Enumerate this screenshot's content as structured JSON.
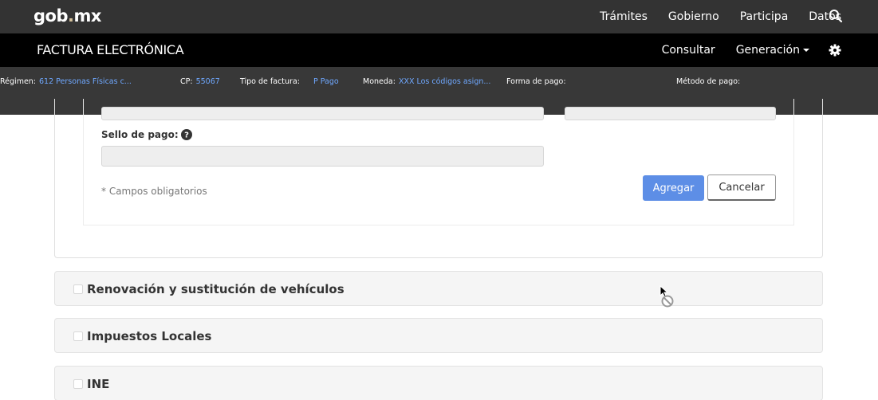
{
  "topbar": {
    "logo_left": "gob",
    "logo_dot": ".",
    "logo_right": "mx",
    "nav": [
      "Trámites",
      "Gobierno",
      "Participa",
      "Datos"
    ]
  },
  "subbar": {
    "title": "FACTURA ELECTRÓNICA",
    "consultar": "Consultar",
    "generacion": "Generación"
  },
  "infobar": {
    "regimen_label": "Régimen:",
    "regimen_value": "612 Personas Físicas c...",
    "cp_label": "CP:",
    "cp_value": "55067",
    "tipo_label": "Tipo de factura:",
    "tipo_value": "P Pago",
    "moneda_label": "Moneda:",
    "moneda_value": "XXX Los códigos asign...",
    "forma_label": "Forma de pago:",
    "metodo_label": "Método de pago:"
  },
  "form": {
    "sello_label": "Sello de pago:",
    "required_note": "* Campos obligatorios",
    "agregar_label": "Agregar",
    "cancelar_label": "Cancelar"
  },
  "sections": [
    {
      "title": "Renovación y sustitución de vehículos"
    },
    {
      "title": "Impuestos Locales"
    },
    {
      "title": "INE"
    }
  ],
  "colors": {
    "topbar": "#333333",
    "subbar": "#000000",
    "infobar": "#383838",
    "info_value": "#6fa8ff",
    "primary_button": "#5d8ee6",
    "accordion_bg": "#f5f5f5"
  }
}
